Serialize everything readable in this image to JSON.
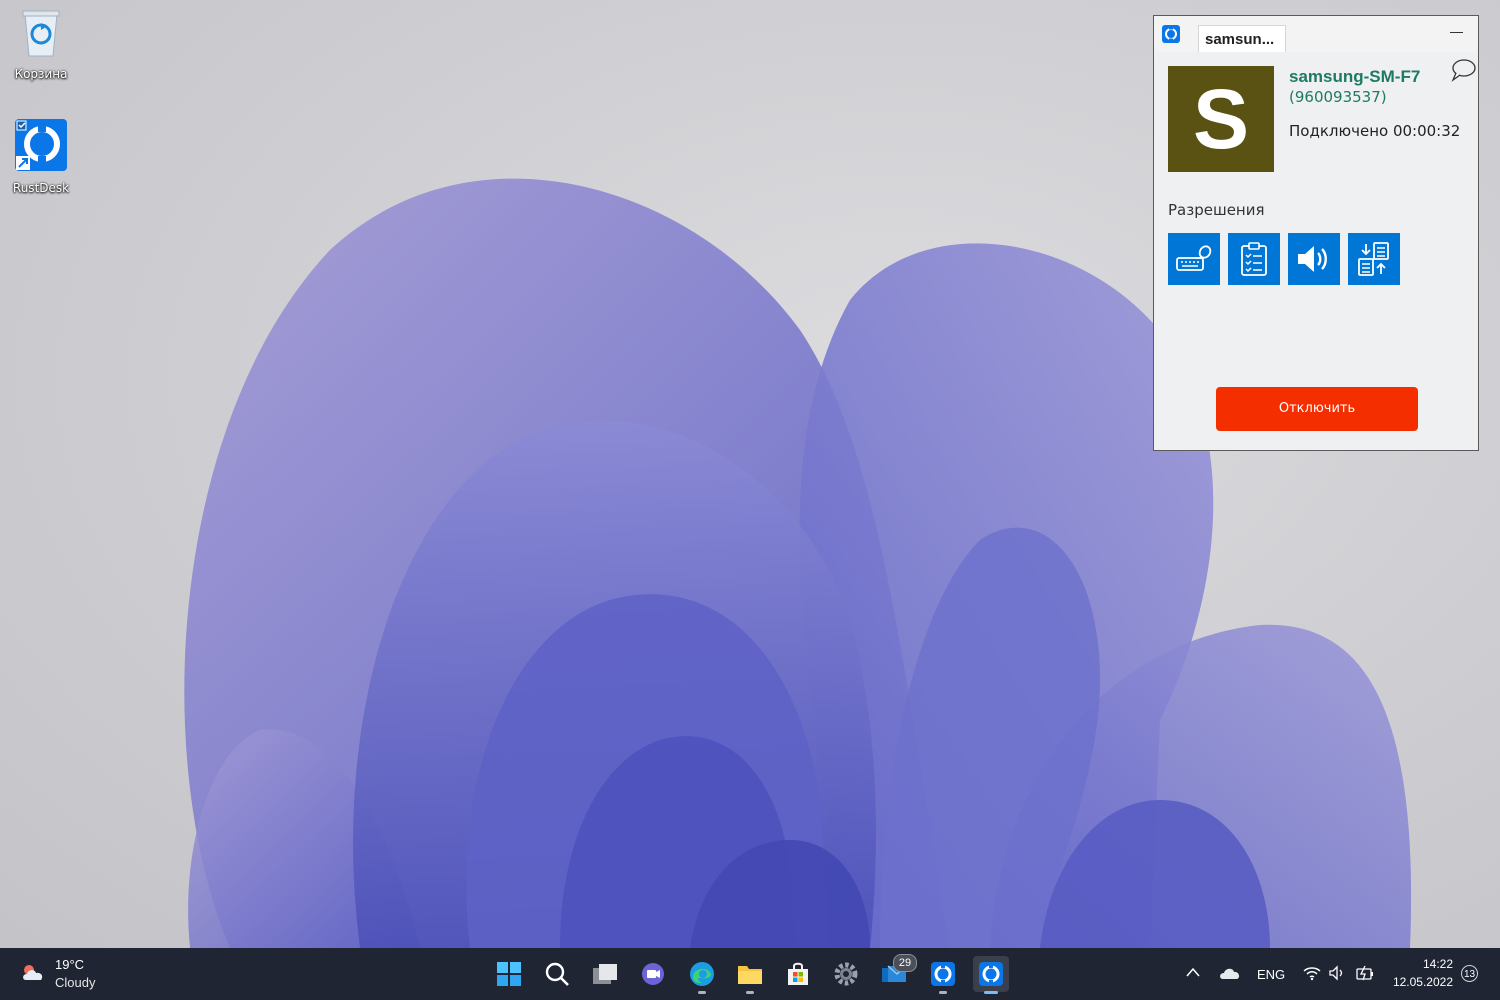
{
  "desktop": {
    "icons": [
      {
        "label": "Корзина",
        "icon": "recycle-bin-icon"
      },
      {
        "label": "RustDesk",
        "icon": "rustdesk-icon"
      }
    ]
  },
  "rd_window": {
    "tab_title": "samsun...",
    "peer_name": "samsung-SM-F7",
    "peer_id": "(960093537)",
    "avatar_letter": "S",
    "status": "Подключено 00:00:32",
    "permissions_title": "Разрешения",
    "permissions": [
      {
        "icon": "keyboard-mouse-icon"
      },
      {
        "icon": "clipboard-icon"
      },
      {
        "icon": "audio-icon"
      },
      {
        "icon": "file-transfer-icon"
      }
    ],
    "disconnect_label": "Отключить",
    "colors": {
      "accent": "#0076d7",
      "disconnect": "#f52e00",
      "peer_text": "#1f7a63",
      "avatar_bg": "#5a5213"
    }
  },
  "taskbar": {
    "weather_temp": "19°C",
    "weather_desc": "Cloudy",
    "app_icons": [
      "start-icon",
      "search-icon",
      "task-view-icon",
      "chat-icon",
      "edge-icon",
      "file-explorer-icon",
      "store-icon",
      "settings-icon",
      "mail-icon",
      "rustdesk-icon",
      "rustdesk-icon"
    ],
    "mail_badge": "29",
    "lang": "ENG",
    "time": "14:22",
    "date": "12.05.2022",
    "notifications": "13"
  }
}
